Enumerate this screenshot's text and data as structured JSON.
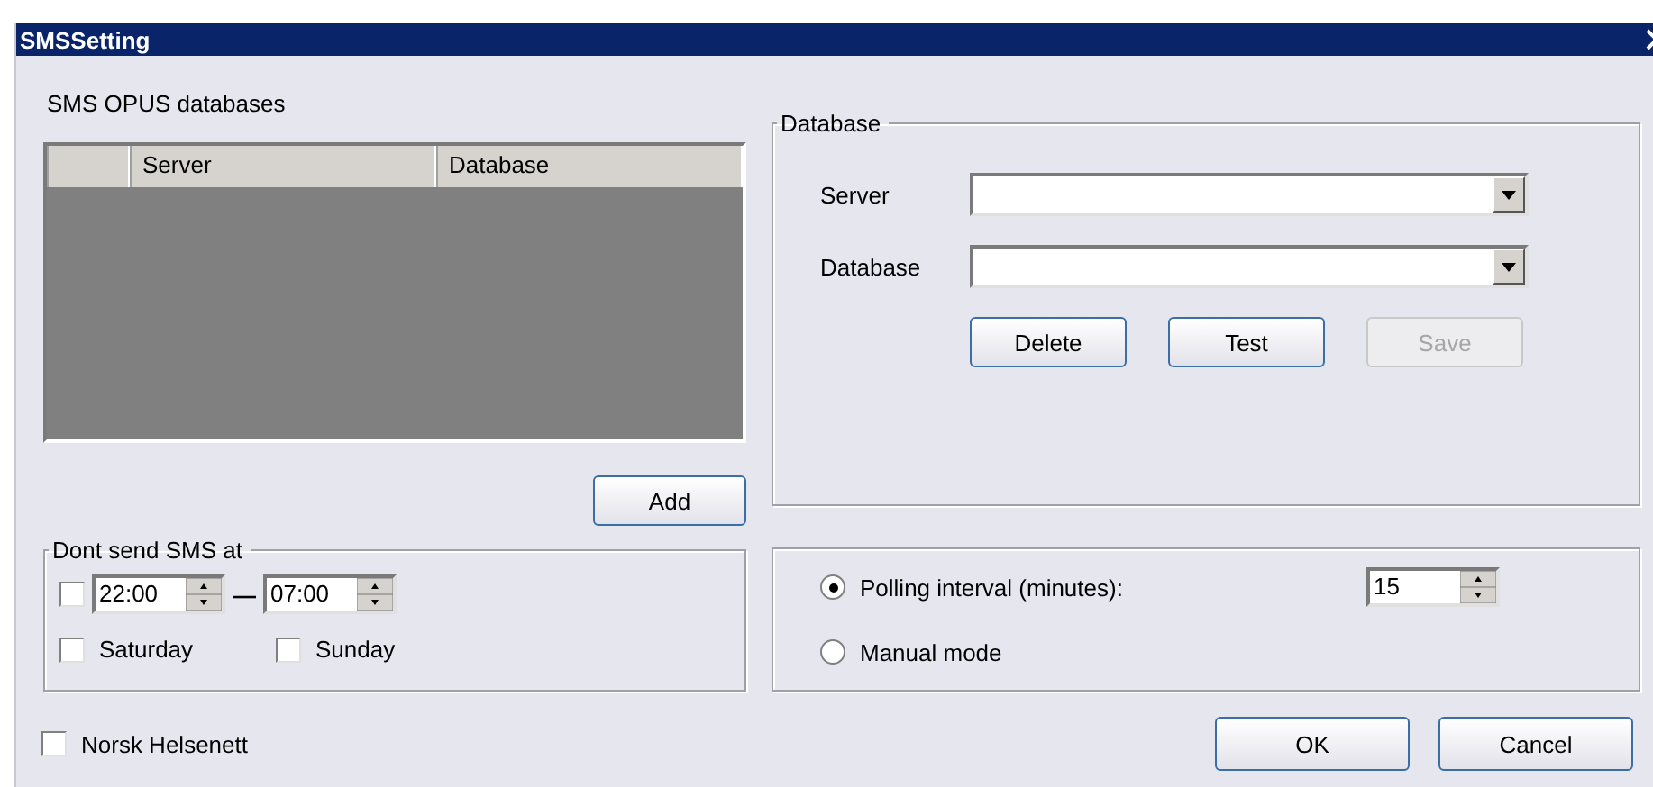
{
  "window": {
    "title": "SMSSetting"
  },
  "databases": {
    "label": "SMS OPUS databases",
    "columns": [
      "Server",
      "Database"
    ],
    "add_button": "Add"
  },
  "database_group": {
    "legend": "Database",
    "fields": [
      "Server",
      "Database"
    ],
    "buttons": [
      {
        "label": "Delete",
        "disabled": false
      },
      {
        "label": "Test",
        "disabled": false
      },
      {
        "label": "Save",
        "disabled": true
      }
    ]
  },
  "dont_send": {
    "legend": "Dont send SMS at",
    "checked": false,
    "from": "22:00",
    "separator": "—",
    "to": "07:00",
    "days": [
      {
        "label": "Saturday",
        "checked": false
      },
      {
        "label": "Sunday",
        "checked": false
      }
    ]
  },
  "mode": {
    "options": [
      {
        "label": "Polling interval (minutes):",
        "selected": true
      },
      {
        "label": "Manual mode",
        "selected": false
      }
    ],
    "interval": "15"
  },
  "norsk_helsenett": {
    "label": "Norsk Helsenett",
    "checked": false
  },
  "buttons": [
    "OK",
    "Cancel"
  ]
}
